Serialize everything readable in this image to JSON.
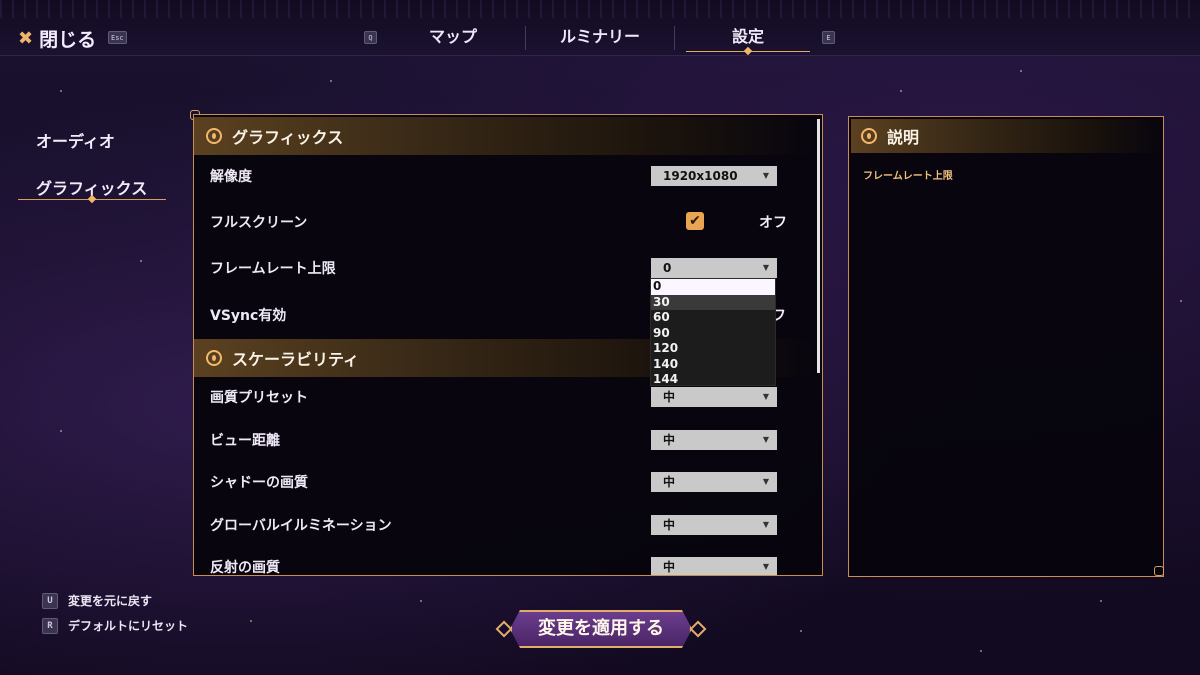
{
  "topbar": {
    "close_label": "閉じる",
    "close_key": "Esc",
    "prev_key": "Q",
    "next_key": "E",
    "tabs": [
      {
        "label": "マップ"
      },
      {
        "label": "ルミナリー"
      },
      {
        "label": "設定"
      }
    ],
    "active_tab": "設定"
  },
  "sidebar": {
    "items": [
      {
        "label": "オーディオ"
      },
      {
        "label": "グラフィックス"
      }
    ],
    "active": "グラフィックス"
  },
  "settings": {
    "graphics_header": "グラフィックス",
    "resolution": {
      "label": "解像度",
      "value": "1920x1080"
    },
    "fullscreen": {
      "label": "フルスクリーン",
      "checked": true,
      "state_text": "オフ"
    },
    "framerate": {
      "label": "フレームレート上限",
      "value": "0",
      "options": [
        "0",
        "30",
        "60",
        "90",
        "120",
        "140",
        "144"
      ]
    },
    "vsync": {
      "label": "VSync有効",
      "state_text": "フ"
    },
    "scalability_header": "スケーラビリティ",
    "quality_preset": {
      "label": "画質プリセット",
      "value": "中"
    },
    "view_distance": {
      "label": "ビュー距離",
      "value": "中"
    },
    "shadow_quality": {
      "label": "シャドーの画質",
      "value": "中"
    },
    "global_illumination": {
      "label": "グローバルイルミネーション",
      "value": "中"
    },
    "reflection_quality": {
      "label": "反射の画質",
      "value": "中"
    }
  },
  "description": {
    "header": "説明",
    "text": "フレームレート上限"
  },
  "footer": {
    "undo_key": "U",
    "undo_label": "変更を元に戻す",
    "reset_key": "R",
    "reset_label": "デフォルトにリセット",
    "apply_label": "変更を適用する"
  },
  "colors": {
    "accent_gold": "#e2ad6a",
    "button_purple": "#5a2f7a",
    "dropdown_bg": "#c9c9c9"
  }
}
